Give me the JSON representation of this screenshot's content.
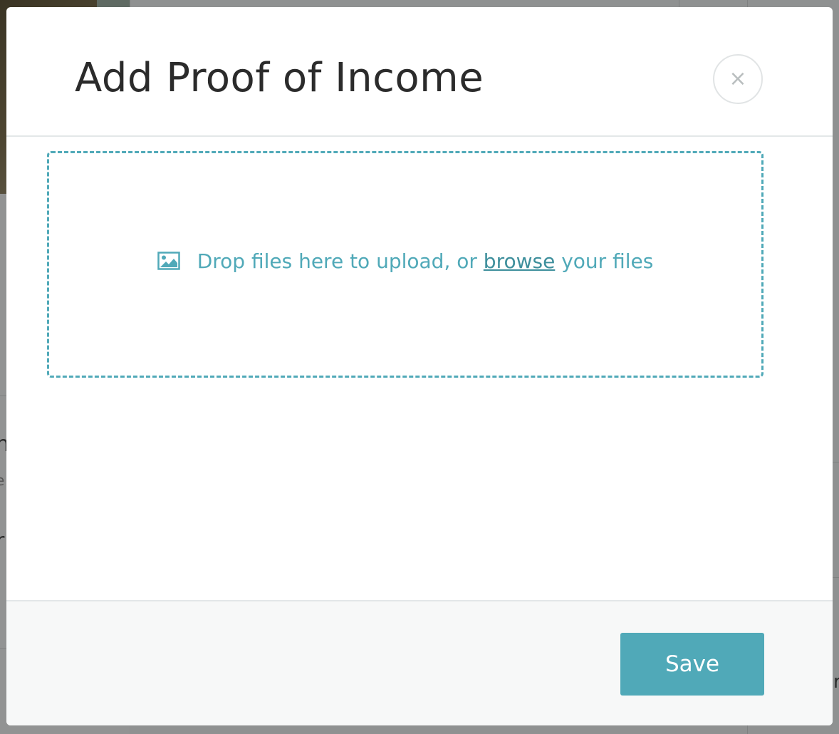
{
  "modal": {
    "title": "Add Proof of Income",
    "close_label": "×"
  },
  "dropzone": {
    "prefix": "Drop files here to upload, or ",
    "link": "browse",
    "suffix": " your files",
    "icon": "image-icon"
  },
  "footer": {
    "save_label": "Save"
  },
  "background": {
    "fragments": [
      "n",
      "e",
      "r",
      "r"
    ]
  },
  "colors": {
    "accent": "#50a9b8",
    "title": "#2b2b2b",
    "overlay": "#8f9191"
  }
}
